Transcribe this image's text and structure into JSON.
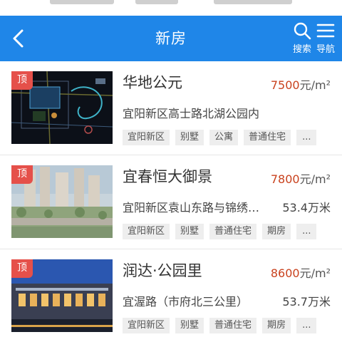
{
  "header": {
    "title": "新房",
    "search_label": "搜索",
    "nav_label": "导航",
    "color": "#1f86e8"
  },
  "badge_label": "顶",
  "listings": [
    {
      "name": "华地公元",
      "price_value": "7500",
      "price_unit": "元/m²",
      "address": "宜阳新区高士路北湖公园内",
      "total": "",
      "tags": [
        "宜阳新区",
        "别墅",
        "公寓",
        "普通住宅",
        "..."
      ]
    },
    {
      "name": "宜春恒大御景",
      "price_value": "7800",
      "price_unit": "元/m²",
      "address": "宜阳新区袁山东路与锦绣…",
      "total": "53.4万米",
      "tags": [
        "宜阳新区",
        "别墅",
        "普通住宅",
        "期房",
        "..."
      ]
    },
    {
      "name": "润达·公园里",
      "price_value": "8600",
      "price_unit": "元/m²",
      "address": "宜渥路（市府北三公里）",
      "total": "53.7万米",
      "tags": [
        "宜阳新区",
        "别墅",
        "普通住宅",
        "期房",
        "..."
      ]
    }
  ]
}
